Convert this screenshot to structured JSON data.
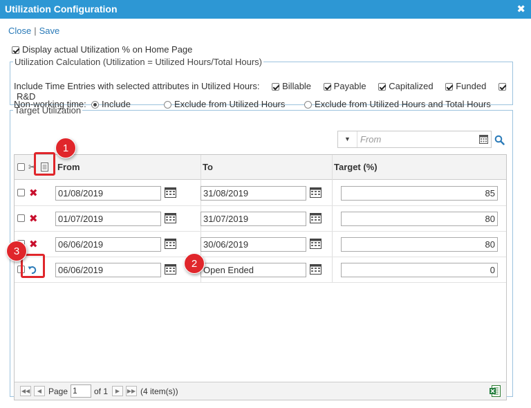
{
  "window": {
    "title": "Utilization Configuration",
    "close_glyph": "✖"
  },
  "links": {
    "close": "Close",
    "separator": "|",
    "save": "Save"
  },
  "display_util": {
    "label": "Display actual Utilization % on Home Page",
    "checked": true
  },
  "util_calc": {
    "legend": "Utilization Calculation (Utilization = Utilized Hours/Total Hours)",
    "include_label": "Include Time Entries with selected attributes in Utilized Hours:",
    "attributes": [
      {
        "label": "Billable",
        "checked": true
      },
      {
        "label": "Payable",
        "checked": true
      },
      {
        "label": "Capitalized",
        "checked": true
      },
      {
        "label": "Funded",
        "checked": true
      },
      {
        "label": "R&D",
        "checked": true
      }
    ],
    "nonworking_label": "Non-working time:",
    "options": [
      {
        "label": "Include",
        "selected": true
      },
      {
        "label": "Exclude from Utilized Hours",
        "selected": false
      },
      {
        "label": "Exclude from Utilized Hours and Total Hours",
        "selected": false
      }
    ]
  },
  "target": {
    "legend": "Target Utilization",
    "filter_placeholder": "From",
    "columns": {
      "from": "From",
      "to": "To",
      "target": "Target (%)"
    },
    "rows": [
      {
        "from": "01/08/2019",
        "to": "31/08/2019",
        "target": "85",
        "action": "delete"
      },
      {
        "from": "01/07/2019",
        "to": "31/07/2019",
        "target": "80",
        "action": "delete"
      },
      {
        "from": "06/06/2019",
        "to": "30/06/2019",
        "target": "80",
        "action": "delete"
      },
      {
        "from": "06/06/2019",
        "to": "Open Ended",
        "target": "0",
        "action": "undo"
      }
    ],
    "pager": {
      "page_label": "Page",
      "page_value": "1",
      "of_label": "of 1",
      "items_label": "(4 item(s))"
    }
  },
  "callouts": [
    "1",
    "2",
    "3"
  ],
  "colors": {
    "titlebar": "#2d97d4",
    "accent": "#2a7ab8",
    "callout": "#e0262b",
    "delete": "#c8102e"
  }
}
